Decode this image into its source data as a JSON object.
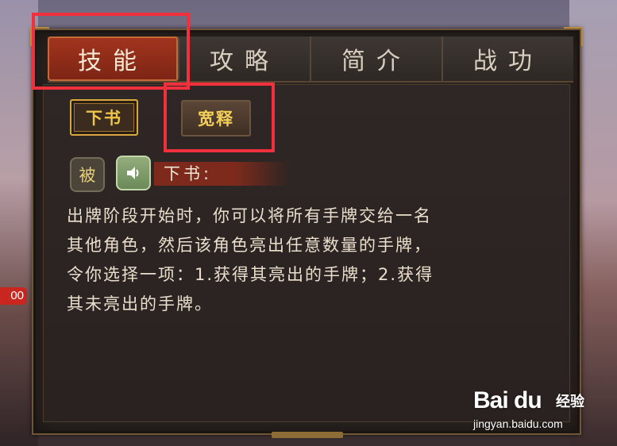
{
  "background": {
    "counter_badge": "00"
  },
  "tabs": [
    {
      "label": "技能",
      "active": true
    },
    {
      "label": "攻略",
      "active": false
    },
    {
      "label": "简介",
      "active": false
    },
    {
      "label": "战功",
      "active": false
    }
  ],
  "skills": {
    "selected_label": "下书",
    "other_label": "宽释"
  },
  "skill_detail": {
    "type_badge": "被",
    "title": "下书:",
    "description": "出牌阶段开始时，你可以将所有手牌交给一名\n其他角色，然后该角色亮出任意数量的手牌，\n令你选择一项：1.获得其亮出的手牌；2.获得\n其未亮出的手牌。"
  },
  "watermark": {
    "logo": "Bai du",
    "sub": "经验",
    "url": "jingyan.baidu.com"
  },
  "colors": {
    "highlight": "#f0303c",
    "active_tab": "#a2351e",
    "gold_text": "#f0c64a"
  }
}
